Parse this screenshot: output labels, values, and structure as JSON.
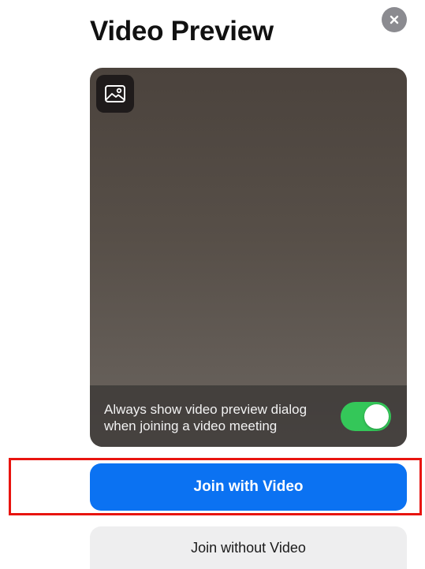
{
  "dialog": {
    "title": "Video Preview",
    "close_icon": "close-icon",
    "background_icon": "image-icon"
  },
  "preview": {
    "settings_text": "Always show video preview dialog when joining a video meeting",
    "always_show_enabled": true
  },
  "actions": {
    "join_with_video": "Join with Video",
    "join_without_video": "Join without Video"
  },
  "colors": {
    "primary": "#0b72f2",
    "toggle_on": "#34c759",
    "highlight": "#e8140f"
  }
}
